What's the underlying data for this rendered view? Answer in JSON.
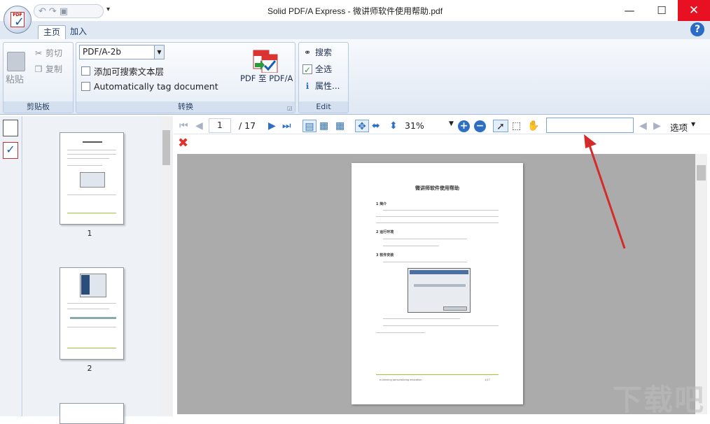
{
  "window": {
    "title": "Solid PDF/A Express - 微讲师软件使用帮助.pdf",
    "minimize": "—",
    "maximize": "☐",
    "close": "✕"
  },
  "qat": {
    "undo": "↶",
    "redo": "↷",
    "save": "▣",
    "more": "▾"
  },
  "ribbon": {
    "tabs": [
      {
        "label": "主页"
      },
      {
        "label": "加入"
      }
    ],
    "help": "?",
    "clipboard": {
      "paste": "粘贴",
      "cut": "剪切",
      "copy": "复制",
      "group": "剪贴板"
    },
    "convert": {
      "preset": "PDF/A-2b",
      "add_text_layer": "添加可搜索文本层",
      "auto_tag": "Automatically tag document",
      "to_pdfa": "PDF 至 PDF/A",
      "group": "转换"
    },
    "edit": {
      "search": "搜索",
      "select_all": "全选",
      "properties": "属性...",
      "group": "Edit"
    }
  },
  "navigation": {
    "page": "1",
    "total": "/ 17",
    "zoom": "31%",
    "options": "选项"
  },
  "thumbnails": [
    {
      "label": "1"
    },
    {
      "label": "2"
    }
  ],
  "document": {
    "title": "微讲师软件使用帮助",
    "sections": [
      "1 简介",
      "2 运行环境",
      "3 软件安装"
    ],
    "footer_left": "e-learning personalizing education",
    "footer_right": "1/17"
  },
  "watermark": "下载吧"
}
